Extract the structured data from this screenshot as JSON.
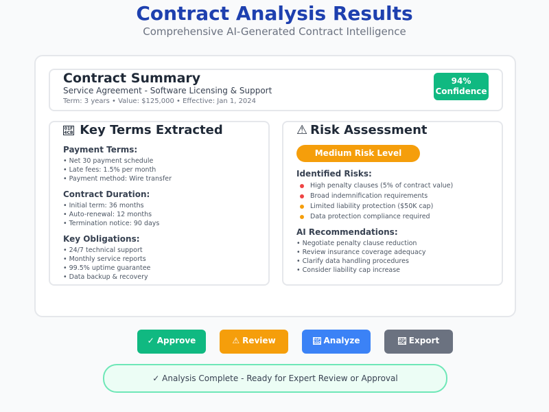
{
  "header": {
    "title": "Contract Analysis Results",
    "subtitle": "Comprehensive AI-Generated Contract Intelligence"
  },
  "summary": {
    "title": "Contract Summary",
    "type": "Service Agreement - Software Licensing & Support",
    "meta": "Term: 3 years • Value: $125,000 • Effective: Jan 1, 2024",
    "confidence_value": "94%",
    "confidence_label": "Confidence"
  },
  "key_terms": {
    "icon": "clipboard-glyph-icon",
    "title": "Key Terms Extracted",
    "sections": [
      {
        "heading": "Payment Terms:",
        "items": [
          "• Net 30 payment schedule",
          "• Late fees: 1.5% per month",
          "• Payment method: Wire transfer"
        ]
      },
      {
        "heading": "Contract Duration:",
        "items": [
          "• Initial term: 36 months",
          "• Auto-renewal: 12 months",
          "• Termination notice: 90 days"
        ]
      },
      {
        "heading": "Key Obligations:",
        "items": [
          "• 24/7 technical support",
          "• Monthly service reports",
          "• 99.5% uptime guarantee",
          "• Data backup & recovery"
        ]
      }
    ]
  },
  "risk": {
    "icon": "warning-icon",
    "icon_glyph": "⚠",
    "title": "Risk Assessment",
    "level": "Medium Risk Level",
    "identified_heading": "Identified Risks:",
    "identified": [
      {
        "text": "High penalty clauses (5% of contract value)",
        "color": "#ef4444"
      },
      {
        "text": "Broad indemnification requirements",
        "color": "#ef4444"
      },
      {
        "text": "Limited liability protection ($50K cap)",
        "color": "#f59e0b"
      },
      {
        "text": "Data protection compliance required",
        "color": "#f59e0b"
      }
    ],
    "recommendations_heading": "AI Recommendations:",
    "recommendations": [
      "• Negotiate penalty clause reduction",
      "• Review insurance coverage adequacy",
      "• Clarify data handling procedures",
      "• Consider liability cap increase"
    ]
  },
  "actions": [
    {
      "label": "Approve",
      "glyph": "✓",
      "icon": "check-icon",
      "color": "#10b981"
    },
    {
      "label": "Review",
      "glyph": "⚠",
      "icon": "warning-icon",
      "color": "#f59e0b"
    },
    {
      "label": "Analyze",
      "glyph": "",
      "icon": "chart-glyph-icon",
      "color": "#3b82f6"
    },
    {
      "label": "Export",
      "glyph": "",
      "icon": "export-glyph-icon",
      "color": "#6b7280"
    }
  ],
  "status": {
    "glyph": "✓",
    "text": "Analysis Complete - Ready for Expert Review or Approval"
  },
  "colors": {
    "title": "#1e40af",
    "success": "#10b981",
    "warning": "#f59e0b",
    "danger": "#ef4444",
    "info": "#3b82f6",
    "neutral": "#6b7280"
  }
}
